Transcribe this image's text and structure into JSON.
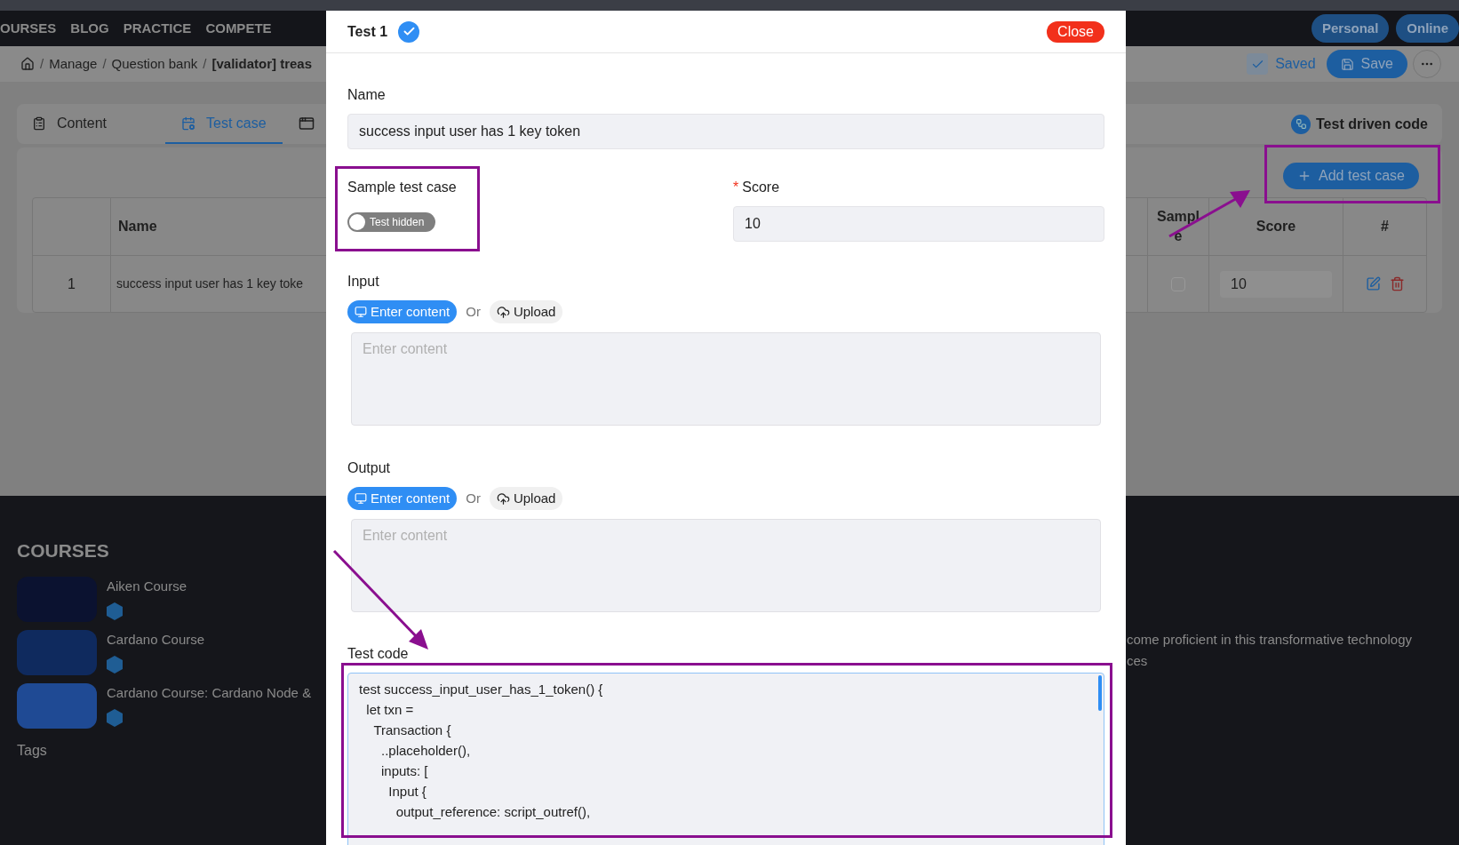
{
  "nav": {
    "items": [
      "OURSES",
      "BLOG",
      "PRACTICE",
      "COMPETE"
    ],
    "buttons": [
      "Personal",
      "Online"
    ]
  },
  "breadcrumb": {
    "items": [
      "Manage",
      "Question bank"
    ],
    "separator": "/",
    "current": "[validator] treas",
    "saved": "Saved",
    "save": "Save"
  },
  "tabs": [
    {
      "kind": "content",
      "label": "Content",
      "selected": false
    },
    {
      "kind": "testcase",
      "label": "Test case",
      "selected": true
    },
    {
      "kind": "code",
      "selected": false
    }
  ],
  "test_driven": "Test driven code",
  "add_button": "Add test case",
  "table": {
    "columns": [
      "Name",
      "Sample",
      "Score",
      "#"
    ],
    "rows": [
      {
        "index": "1",
        "name": "success input user has 1 key toke",
        "sample": false,
        "score": "10"
      }
    ]
  },
  "footer": {
    "title": "COURSES",
    "courses": [
      "Aiken Course",
      "Cardano Course",
      "Cardano Course: Cardano Node &"
    ],
    "tags": "Tags",
    "text_lines": [
      "come proficient in this transformative technology",
      "ces"
    ]
  },
  "modal": {
    "title": "Test 1",
    "verified": true,
    "close": "Close",
    "name": {
      "label": "Name",
      "value": "success input user has 1 key token"
    },
    "sample": {
      "label": "Sample test case",
      "on": false,
      "text": "Test hidden"
    },
    "score": {
      "label": "Score",
      "required_mark": "*",
      "value": "10"
    },
    "sections": [
      {
        "label": "Input",
        "or": "Or",
        "placeholder": "Enter content",
        "modes": [
          {
            "kind": "text",
            "label": "Enter content",
            "selected": true
          },
          {
            "kind": "upload",
            "label": "Upload",
            "selected": false
          }
        ]
      },
      {
        "label": "Output",
        "or": "Or",
        "placeholder": "Enter content",
        "modes": [
          {
            "kind": "text",
            "label": "Enter content",
            "selected": true
          },
          {
            "kind": "upload",
            "label": "Upload",
            "selected": false
          }
        ]
      }
    ],
    "code": {
      "label": "Test code",
      "value": "test success_input_user_has_1_token() {\n  let txn =\n    Transaction {\n      ..placeholder(),\n      inputs: [\n        Input {\n          output_reference: script_outref(),"
    }
  }
}
